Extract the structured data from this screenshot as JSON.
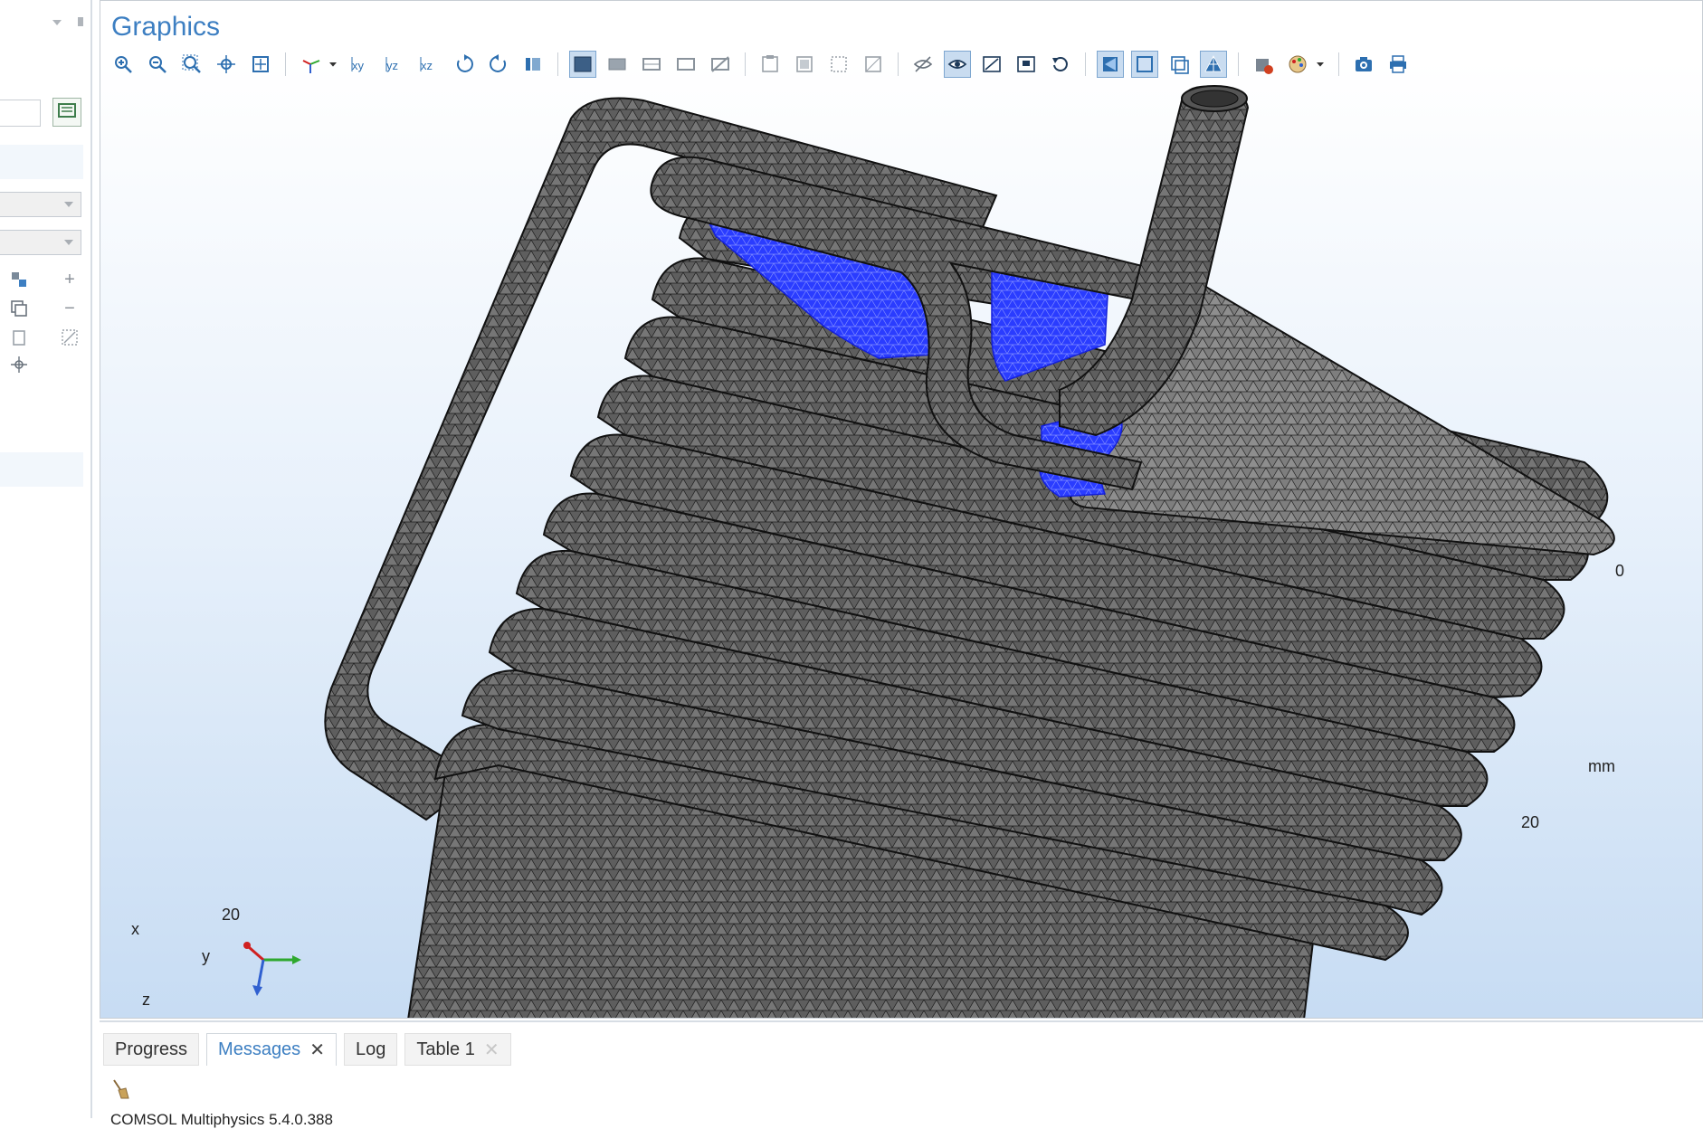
{
  "graphics": {
    "title": "Graphics",
    "toolbar": [
      {
        "name": "zoom-in-icon"
      },
      {
        "name": "zoom-out-icon"
      },
      {
        "name": "zoom-box-icon"
      },
      {
        "name": "zoom-selected-icon"
      },
      {
        "name": "zoom-extents-icon"
      },
      {
        "sep": true
      },
      {
        "name": "axis-orientation-icon"
      },
      {
        "name": "dropdown-arrow-icon"
      },
      {
        "name": "view-xy-icon"
      },
      {
        "name": "view-yz-icon"
      },
      {
        "name": "view-xz-icon"
      },
      {
        "name": "rotate-ccw-icon"
      },
      {
        "name": "rotate-cw-icon"
      },
      {
        "name": "go-to-view-icon"
      },
      {
        "sep": true
      },
      {
        "name": "select-objects-icon",
        "active": true
      },
      {
        "name": "select-domains-icon"
      },
      {
        "name": "select-boundaries-icon"
      },
      {
        "name": "select-edges-icon"
      },
      {
        "name": "select-points-icon"
      },
      {
        "sep": true
      },
      {
        "name": "hide-geometry-icon"
      },
      {
        "name": "show-hidden-icon"
      },
      {
        "name": "reset-hiding-icon"
      },
      {
        "name": "hide-selected-icon"
      },
      {
        "sep": true
      },
      {
        "name": "wireframe-off-icon"
      },
      {
        "name": "show-eye-icon",
        "active": true
      },
      {
        "name": "clip-plane-icon"
      },
      {
        "name": "cut-plane-icon"
      },
      {
        "name": "undo-view-icon"
      },
      {
        "sep": true
      },
      {
        "name": "scene-light-icon",
        "active": true
      },
      {
        "name": "transparency-icon",
        "active": true
      },
      {
        "name": "wireframe-icon"
      },
      {
        "name": "render-mesh-icon",
        "active": true
      },
      {
        "sep": true
      },
      {
        "name": "reset-view-icon"
      },
      {
        "name": "color-palette-icon"
      },
      {
        "name": "dropdown-arrow-icon"
      },
      {
        "sep": true
      },
      {
        "name": "camera-icon"
      },
      {
        "name": "print-icon"
      }
    ],
    "axis_ticks": [
      {
        "name": "axis-tick-0",
        "text": "0"
      },
      {
        "name": "axis-unit-mm",
        "text": "mm"
      },
      {
        "name": "axis-tick-20-right",
        "text": "20"
      },
      {
        "name": "axis-tick-20-left",
        "text": "20"
      }
    ],
    "triad": {
      "x": "x",
      "y": "y",
      "z": "z"
    },
    "colors": {
      "mesh": "#5a5a5a",
      "selection": "#1a2bff",
      "title": "#3d7fc2"
    }
  },
  "bottom_panel": {
    "tabs": [
      {
        "label": "Progress",
        "active": false,
        "closable": false
      },
      {
        "label": "Messages",
        "active": true,
        "closable": true
      },
      {
        "label": "Log",
        "active": false,
        "closable": false
      },
      {
        "label": "Table 1",
        "active": false,
        "closable": true
      }
    ],
    "message_line": "COMSOL Multiphysics 5.4.0.388"
  }
}
